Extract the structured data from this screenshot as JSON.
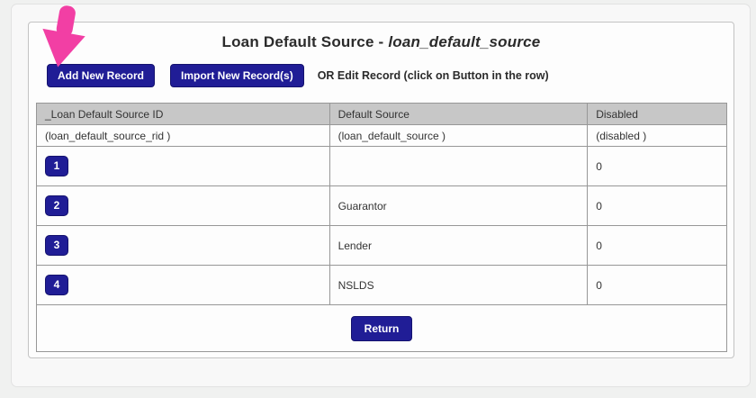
{
  "window": {
    "title": "Loan Default Source - ",
    "title_italic": "loan_default_source"
  },
  "toolbar": {
    "add_label": "Add New Record",
    "import_label": "Import New Record(s)",
    "hint": "OR Edit Record (click on Button in the row)"
  },
  "table": {
    "headers": {
      "id": "_Loan Default Source ID",
      "source": "Default Source",
      "disabled": "Disabled"
    },
    "field_names": {
      "id": "(loan_default_source_rid )",
      "source": "(loan_default_source )",
      "disabled": "(disabled )"
    },
    "rows": [
      {
        "button": "1",
        "source": "",
        "disabled": "0"
      },
      {
        "button": "2",
        "source": "Guarantor",
        "disabled": "0"
      },
      {
        "button": "3",
        "source": "Lender",
        "disabled": "0"
      },
      {
        "button": "4",
        "source": "NSLDS",
        "disabled": "0"
      }
    ],
    "footer": {
      "return_label": "Return"
    }
  },
  "annotation": {
    "arrow_meaning": "pink arrow pointing at Add New Record button"
  },
  "colors": {
    "button_navy": "#201d96",
    "arrow_pink": "#f23fa4",
    "header_bg": "#c7c7c7",
    "page_bg": "#f0f1f0"
  }
}
